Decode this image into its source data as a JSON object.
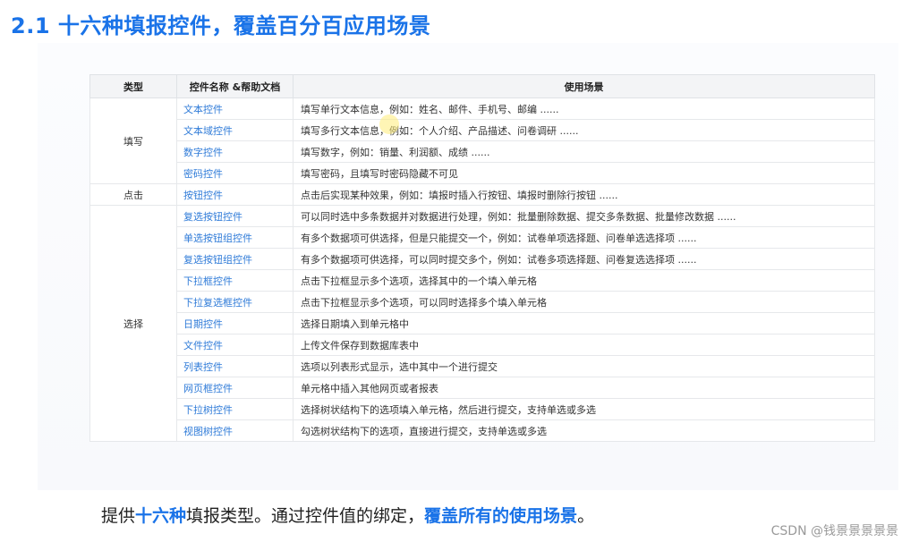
{
  "title": "2.1 十六种填报控件，覆盖百分百应用场景",
  "table": {
    "headers": [
      "类型",
      "控件名称 &帮助文档",
      "使用场景"
    ],
    "groups": [
      {
        "category": "填写",
        "rows": [
          {
            "name": "文本控件",
            "scenario": "填写单行文本信息，例如：姓名、邮件、手机号、邮编 ......"
          },
          {
            "name": "文本域控件",
            "scenario": "填写多行文本信息，例如：个人介绍、产品描述、问卷调研 ......"
          },
          {
            "name": "数字控件",
            "scenario": "填写数字，例如：销量、利润额、成绩 ......"
          },
          {
            "name": "密码控件",
            "scenario": "填写密码，且填写时密码隐藏不可见"
          }
        ]
      },
      {
        "category": "点击",
        "rows": [
          {
            "name": "按钮控件",
            "scenario": "点击后实现某种效果，例如：填报时插入行按钮、填报时删除行按钮 ......"
          }
        ]
      },
      {
        "category": "选择",
        "rows": [
          {
            "name": "复选按钮控件",
            "scenario": "可以同时选中多条数据并对数据进行处理，例如：批量删除数据、提交多条数据、批量修改数据 ......"
          },
          {
            "name": "单选按钮组控件",
            "scenario": "有多个数据项可供选择，但是只能提交一个，例如：试卷单项选择题、问卷单选选择项 ......"
          },
          {
            "name": "复选按钮组控件",
            "scenario": "有多个数据项可供选择，可以同时提交多个，例如：试卷多项选择题、问卷复选选择项 ......"
          },
          {
            "name": "下拉框控件",
            "scenario": "点击下拉框显示多个选项，选择其中的一个填入单元格"
          },
          {
            "name": "下拉复选框控件",
            "scenario": "点击下拉框显示多个选项，可以同时选择多个填入单元格"
          },
          {
            "name": "日期控件",
            "scenario": "选择日期填入到单元格中"
          },
          {
            "name": "文件控件",
            "scenario": "上传文件保存到数据库表中"
          },
          {
            "name": "列表控件",
            "scenario": "选项以列表形式显示，选中其中一个进行提交"
          },
          {
            "name": "网页框控件",
            "scenario": "单元格中插入其他网页或者报表"
          },
          {
            "name": "下拉树控件",
            "scenario": "选择树状结构下的选项填入单元格，然后进行提交，支持单选或多选"
          },
          {
            "name": "视图树控件",
            "scenario": "勾选树状结构下的选项，直接进行提交，支持单选或多选"
          }
        ]
      }
    ]
  },
  "footer": {
    "p1": "提供",
    "p2": "十六种",
    "p3": "填报类型。通过控件值的绑定，",
    "p4": "覆盖所有的使用场景",
    "p5": "。"
  },
  "watermark": "CSDN @钱景景景景景",
  "colors": {
    "accent": "#1a73e8",
    "link": "#2f7bd8"
  }
}
